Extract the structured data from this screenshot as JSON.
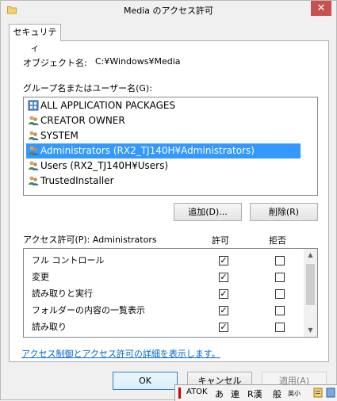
{
  "window": {
    "title": "Media のアクセス許可",
    "close_glyph": "✕"
  },
  "tabs": [
    {
      "label": "セキュリティ"
    }
  ],
  "object": {
    "label": "オブジェクト名:",
    "value": "C:¥Windows¥Media"
  },
  "groups": {
    "label": "グループ名またはユーザー名(G):",
    "items": [
      {
        "label": "ALL APPLICATION PACKAGES",
        "icon": "app-packages-icon"
      },
      {
        "label": "CREATOR OWNER",
        "icon": "users-icon"
      },
      {
        "label": "SYSTEM",
        "icon": "users-icon"
      },
      {
        "label": "Administrators (RX2_TJ140H¥Administrators)",
        "icon": "users-icon",
        "selected": true
      },
      {
        "label": "Users (RX2_TJ140H¥Users)",
        "icon": "users-icon"
      },
      {
        "label": "TrustedInstaller",
        "icon": "users-icon"
      }
    ]
  },
  "buttons": {
    "add": "追加(D)...",
    "remove": "削除(R)",
    "ok": "OK",
    "cancel": "キャンセル",
    "apply": "適用(A)"
  },
  "permissions": {
    "label": "アクセス許可(P): Administrators",
    "allow_header": "許可",
    "deny_header": "拒否",
    "rows": [
      {
        "name": "フル コントロール",
        "allow": true,
        "deny": false
      },
      {
        "name": "変更",
        "allow": true,
        "deny": false
      },
      {
        "name": "読み取りと実行",
        "allow": true,
        "deny": false
      },
      {
        "name": "フォルダーの内容の一覧表示",
        "allow": true,
        "deny": false
      },
      {
        "name": "読み取り",
        "allow": true,
        "deny": false
      }
    ]
  },
  "link_text": "アクセス制御とアクセス許可の詳細を表示します。",
  "ime_bar": {
    "atok": "ATOK",
    "a": "あ",
    "ren": "連",
    "rkan": "R漢",
    "ban": "般",
    "eisho": "英小"
  },
  "colors": {
    "selection": "#3399ff",
    "link": "#0066cc",
    "close": "#c75050"
  }
}
